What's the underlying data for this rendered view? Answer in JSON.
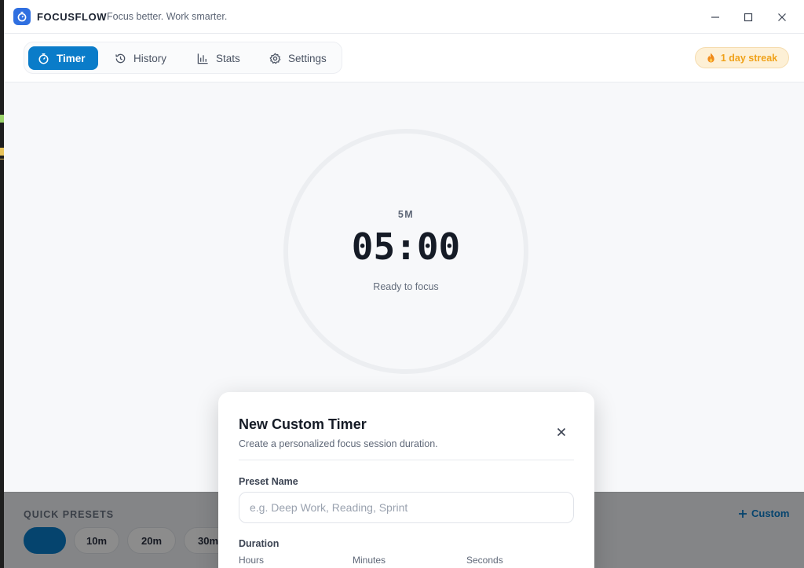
{
  "app": {
    "name": "FOCUSFLOW",
    "tagline": "Focus better. Work smarter.",
    "accent": "#0a7cc9"
  },
  "window_controls": [
    "minimize-icon",
    "maximize-icon",
    "close-icon"
  ],
  "nav": {
    "tabs": [
      {
        "label": "Timer",
        "icon": "stopwatch-icon",
        "active": true
      },
      {
        "label": "History",
        "icon": "history-icon",
        "active": false
      },
      {
        "label": "Stats",
        "icon": "bar-chart-icon",
        "active": false
      },
      {
        "label": "Settings",
        "icon": "gear-icon",
        "active": false
      }
    ],
    "streak": {
      "label": "1 day streak",
      "icon": "flame-icon"
    }
  },
  "timer": {
    "preset": "5M",
    "time": "05:00",
    "status": "Ready to focus"
  },
  "quick_presets": {
    "label": "QUICK PRESETS",
    "custom_label": "Custom",
    "chips": [
      "10m",
      "20m",
      "30m"
    ]
  },
  "modal": {
    "title": "New Custom Timer",
    "subtitle": "Create a personalized focus session duration.",
    "preset_name_label": "Preset Name",
    "preset_name_placeholder": "e.g. Deep Work, Reading, Sprint",
    "preset_name_value": "",
    "duration_label": "Duration",
    "hours_label": "Hours",
    "minutes_label": "Minutes",
    "seconds_label": "Seconds"
  }
}
